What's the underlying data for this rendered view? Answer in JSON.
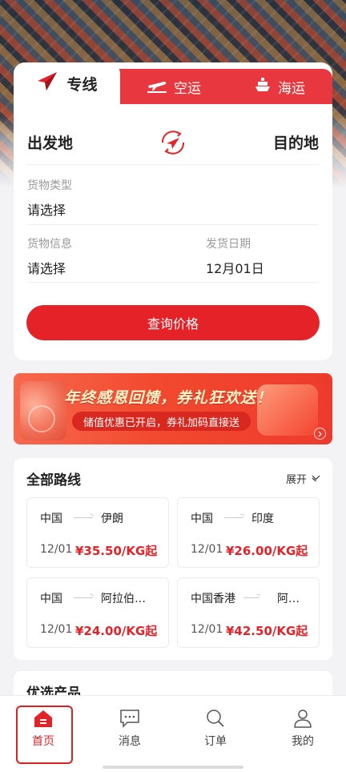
{
  "tabs": {
    "express": "专线",
    "air": "空运",
    "sea": "海运"
  },
  "search": {
    "origin": "出发地",
    "destination": "目的地",
    "cargo_type_label": "货物类型",
    "cargo_type_value": "请选择",
    "cargo_info_label": "货物信息",
    "cargo_info_value": "请选择",
    "ship_date_label": "发货日期",
    "ship_date_value": "12月01日",
    "query_button": "查询价格"
  },
  "banner": {
    "title": "年终感恩回馈，券礼狂欢送！",
    "subtitle": "储值优惠已开启，券礼加码直接送"
  },
  "routes": {
    "title": "全部路线",
    "expand": "展开",
    "items": [
      {
        "from": "中国",
        "to": "伊朗",
        "date": "12/01",
        "price": "¥35.50/KG起"
      },
      {
        "from": "中国",
        "to": "印度",
        "date": "12/01",
        "price": "¥26.00/KG起"
      },
      {
        "from": "中国",
        "to": "阿拉伯…",
        "date": "12/01",
        "price": "¥24.00/KG起"
      },
      {
        "from": "中国香港",
        "to": "阿…",
        "date": "12/01",
        "price": "¥42.50/KG起"
      }
    ]
  },
  "preferred": {
    "title": "优选产品"
  },
  "nav": {
    "home": "首页",
    "messages": "消息",
    "orders": "订单",
    "mine": "我的"
  },
  "colors": {
    "brand_red": "#e42228",
    "tab_red": "#e8373e"
  }
}
